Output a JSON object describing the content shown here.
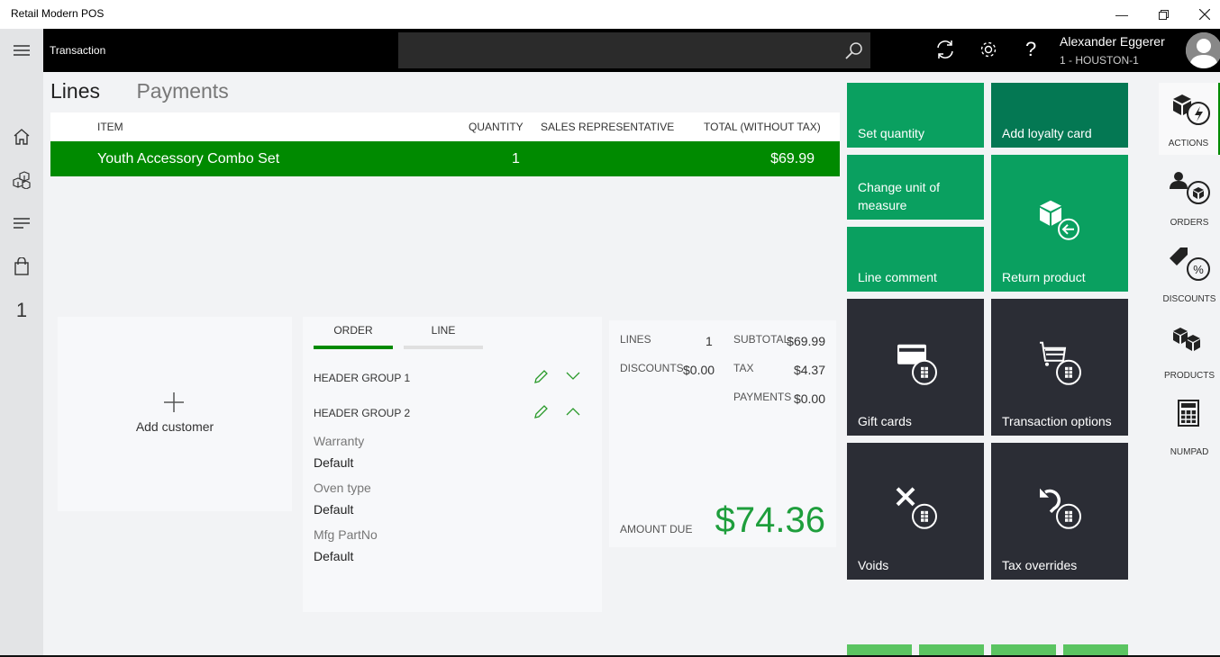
{
  "window": {
    "title": "Retail Modern POS",
    "minimize_icon": "minimize-icon",
    "restore_icon": "restore-icon",
    "close_icon": "close-icon"
  },
  "header": {
    "title": "Transaction",
    "search": {
      "value": "",
      "placeholder": ""
    },
    "icons": [
      "menu-icon",
      "sync-icon",
      "settings-icon",
      "help-icon"
    ],
    "help_label": "?",
    "user": {
      "name": "Alexander Eggerer",
      "store": "1 - HOUSTON-1"
    }
  },
  "leftnav": {
    "items": [
      {
        "icon": "home-icon"
      },
      {
        "icon": "products-icon"
      },
      {
        "icon": "list-icon"
      },
      {
        "icon": "bag-icon"
      },
      {
        "label": "1"
      }
    ]
  },
  "main_tabs": [
    {
      "label": "Lines",
      "active": true
    },
    {
      "label": "Payments",
      "active": false
    }
  ],
  "lines_grid": {
    "columns": [
      "ITEM",
      "QUANTITY",
      "SALES REPRESENTATIVE",
      "TOTAL (WITHOUT TAX)"
    ],
    "rows": [
      {
        "item": "Youth Accessory Combo Set",
        "quantity": "1",
        "sales_rep": "",
        "total": "$69.99",
        "selected": true
      }
    ]
  },
  "customer": {
    "add_label": "Add customer"
  },
  "order_panel": {
    "tabs": [
      {
        "label": "ORDER",
        "active": true
      },
      {
        "label": "LINE",
        "active": false
      }
    ],
    "groups": [
      {
        "label": "HEADER GROUP 1",
        "expanded": false
      },
      {
        "label": "HEADER GROUP 2",
        "expanded": true
      }
    ],
    "attributes": [
      {
        "label": "Warranty",
        "value": "Default"
      },
      {
        "label": "Oven type",
        "value": "Default"
      },
      {
        "label": "Mfg PartNo",
        "value": "Default"
      }
    ]
  },
  "totals": {
    "lines_label": "LINES",
    "lines": "1",
    "discounts_label": "DISCOUNTS",
    "discounts": "$0.00",
    "subtotal_label": "SUBTOTAL",
    "subtotal": "$69.99",
    "tax_label": "TAX",
    "tax": "$4.37",
    "payments_label": "PAYMENTS",
    "payments": "$0.00",
    "amount_due_label": "AMOUNT DUE",
    "amount_due": "$74.36"
  },
  "tiles": [
    {
      "label": "Set quantity",
      "color": "#0aa060"
    },
    {
      "label": "Add loyalty card",
      "color": "#047853"
    },
    {
      "label": "Change unit of measure",
      "color": "#0aa060"
    },
    {
      "label": "Line comment",
      "color": "#0aa060"
    },
    {
      "label": "Return product",
      "color": "#0aa060",
      "icon": "return-product-icon"
    },
    {
      "label": "Gift cards",
      "color": "#2b2d35",
      "icon": "gift-card-icon"
    },
    {
      "label": "Transaction options",
      "color": "#2b2d35",
      "icon": "cart-icon"
    },
    {
      "label": "Voids",
      "color": "#2b2d35",
      "icon": "void-icon"
    },
    {
      "label": "Tax overrides",
      "color": "#2b2d35",
      "icon": "undo-icon"
    }
  ],
  "right_pane": [
    {
      "label": "ACTIONS",
      "active": true
    },
    {
      "label": "ORDERS"
    },
    {
      "label": "DISCOUNTS"
    },
    {
      "label": "PRODUCTS"
    },
    {
      "label": "NUMPAD"
    }
  ],
  "colors": {
    "accent": "#008a00",
    "tile_green": "#0aa060",
    "tile_dark_green": "#047853",
    "tile_dark": "#2b2d35",
    "amount_due": "#1e9e3c"
  }
}
